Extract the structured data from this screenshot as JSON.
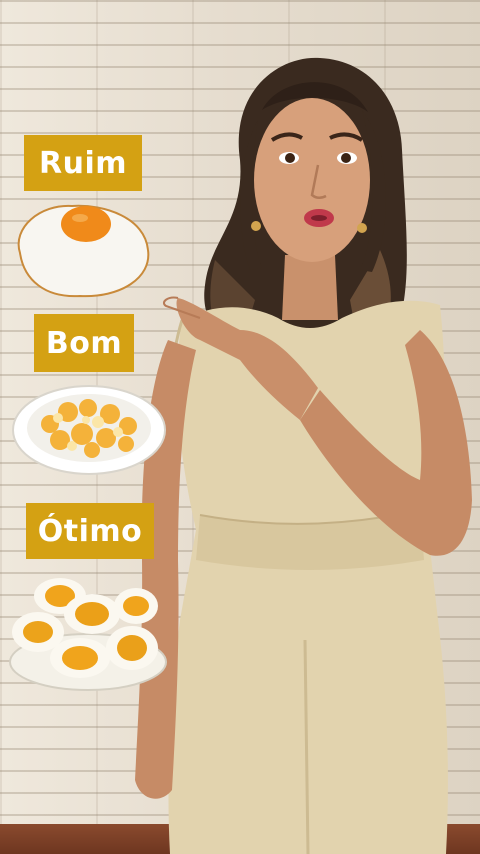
{
  "labels": [
    {
      "text": "Ruim",
      "food": "fried-egg"
    },
    {
      "text": "Bom",
      "food": "scrambled-eggs"
    },
    {
      "text": "Ótimo",
      "food": "boiled-eggs"
    }
  ],
  "colors": {
    "label_background": "#d4a113",
    "label_text": "#ffffff",
    "outfit": "#e2d3ae",
    "wall": "#e7dfd2"
  }
}
